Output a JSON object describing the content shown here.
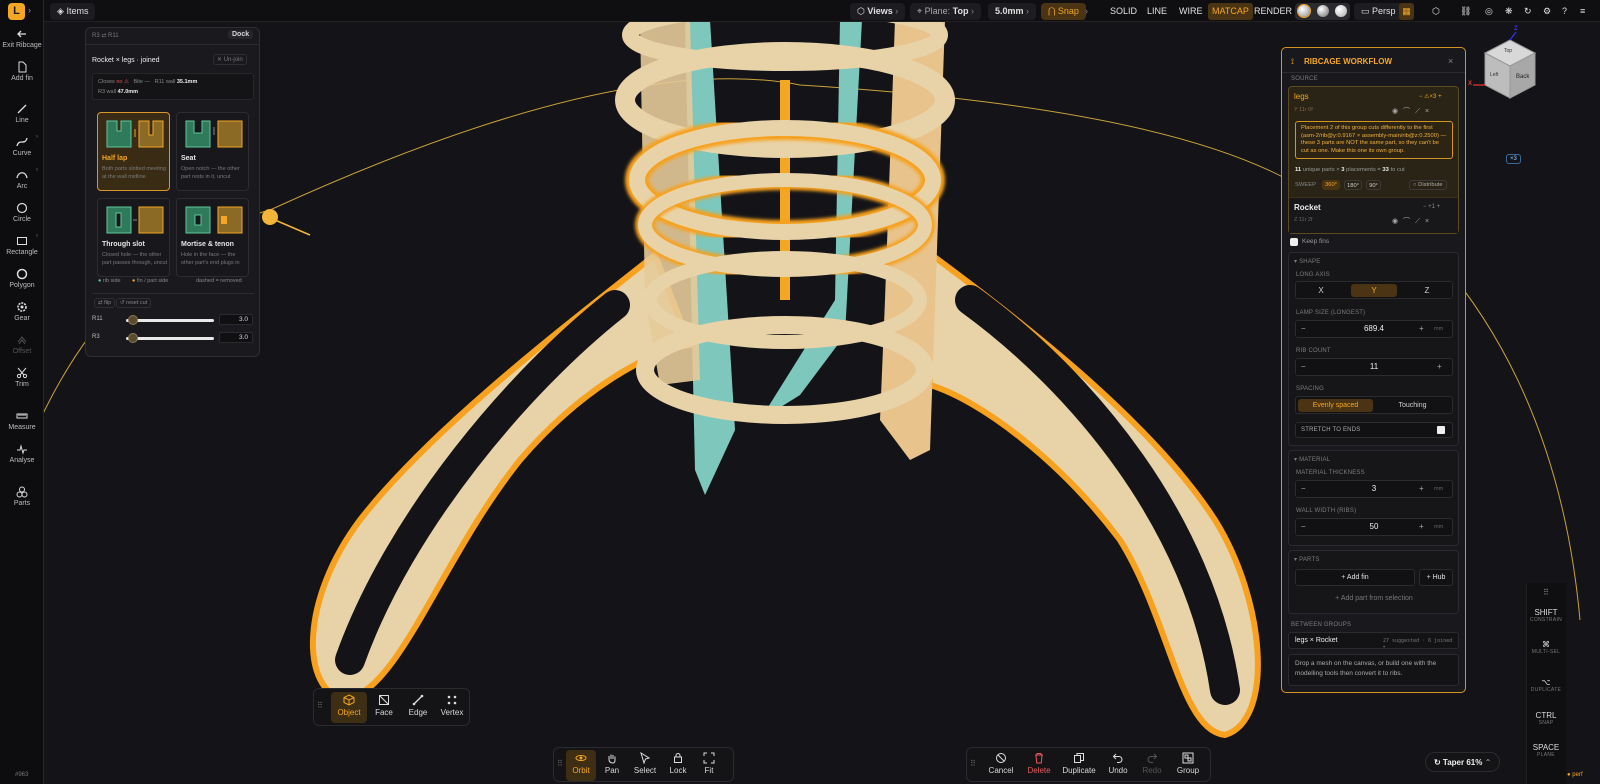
{
  "app": {
    "logo_letter": "L",
    "accent": "#f5a623",
    "build": "#963"
  },
  "left_tools": [
    {
      "label": "Exit Ribcage",
      "icon": "arrow-left-icon"
    },
    {
      "label": "Add fin",
      "icon": "file-icon"
    },
    {
      "label": "Line",
      "icon": "line-icon"
    },
    {
      "label": "Curve",
      "icon": "curve-icon"
    },
    {
      "label": "Arc",
      "icon": "arc-icon"
    },
    {
      "label": "Circle",
      "icon": "circle-icon"
    },
    {
      "label": "Rectangle",
      "icon": "rectangle-icon"
    },
    {
      "label": "Polygon",
      "icon": "polygon-icon"
    },
    {
      "label": "Gear",
      "icon": "gear-icon"
    },
    {
      "label": "Offset",
      "icon": "offset-icon"
    },
    {
      "label": "Trim",
      "icon": "scissors-icon"
    },
    {
      "label": "Measure",
      "icon": "ruler-icon"
    },
    {
      "label": "Analyse",
      "icon": "pulse-icon"
    },
    {
      "label": "Parts",
      "icon": "parts-icon"
    }
  ],
  "topbar": {
    "items_label": "Items",
    "views_label": "Views",
    "plane_label": "Plane:",
    "plane_value": "Top",
    "grid_value": "5.0mm",
    "snap_label": "Snap",
    "modes": [
      "SOLID",
      "LINE",
      "WIRE",
      "MATCAP",
      "RENDER"
    ],
    "active_mode": "MATCAP",
    "projection": "Persp"
  },
  "joint_panel": {
    "header": "R3 ⇄ R11",
    "dock_label": "Dock",
    "title": "Rocket × legs · joined",
    "unjoin_label": "✕ Un-join",
    "closes_label": "Closes",
    "closes_value": "no ⚠",
    "bite_label": "Bite",
    "bite_value": "—",
    "r11_wall_label": "R11 wall",
    "r11_wall_value": "35.1mm",
    "r3_wall_label": "R3 wall",
    "r3_wall_value": "47.0mm",
    "joints": [
      {
        "title": "Half lap",
        "desc": "Both parts slotted meeting at the wall midline",
        "selected": true
      },
      {
        "title": "Seat",
        "desc": "Open notch — the other part rests in it, uncut",
        "selected": false
      },
      {
        "title": "Through slot",
        "desc": "Closed hole — the other part passes through, uncut",
        "selected": false
      },
      {
        "title": "Mortise & tenon",
        "desc": "Hole in the face — the other part's end plugs in",
        "selected": false
      }
    ],
    "legend_rib": "rib side",
    "legend_fin": "fin / part side",
    "legend_dashed": "dashed = removed",
    "flip_label": "⇄ flip",
    "reset_label": "↺ reset cut",
    "sliders": [
      {
        "label": "R11",
        "value": "3.0",
        "fraction": 0.05
      },
      {
        "label": "R3",
        "value": "3.0",
        "fraction": 0.05
      }
    ]
  },
  "workflow": {
    "title": "RIBCAGE WORKFLOW",
    "source_label": "SOURCE",
    "groups": [
      {
        "name": "legs",
        "meta": "Y 11r 0f",
        "badge": "⚠×3"
      },
      {
        "name": "Rocket",
        "meta": "Z 11r 2f",
        "badge": "+1"
      }
    ],
    "warning": "Placement 2 of this group cuts differently to the first (asm-2/rib@y:0.9167 × assembly-main/rib@z:0.2500) — these 3 parts are NOT the same part, so they can't be cut as one. Make this one its own group.",
    "parts_summary_a": "11",
    "parts_summary_b": "unique parts ×",
    "parts_summary_c": "3",
    "parts_summary_d": "placements =",
    "parts_summary_e": "33",
    "parts_summary_f": "to cut",
    "sweep_label": "SWEEP",
    "sweep_options": [
      "360°",
      "180°",
      "90°"
    ],
    "distribute_label": "Distribute",
    "keep_fins_label": "Keep fins",
    "shape_label": "SHAPE",
    "long_axis_label": "LONG AXIS",
    "axes": [
      "X",
      "Y",
      "Z"
    ],
    "active_axis": "Y",
    "lamp_size_label": "LAMP SIZE (LONGEST)",
    "lamp_size": "689.4",
    "rib_count_label": "RIB COUNT",
    "rib_count": "11",
    "spacing_label": "SPACING",
    "spacing_options": [
      "Evenly spaced",
      "Touching"
    ],
    "stretch_label": "STRETCH TO ENDS",
    "material_label": "MATERIAL",
    "thickness_label": "MATERIAL THICKNESS",
    "thickness": "3",
    "wall_label": "WALL WIDTH (RIBS)",
    "wall": "50",
    "unit": "mm",
    "parts_label": "PARTS",
    "add_fin": "+ Add fin",
    "add_hub": "+ Hub",
    "add_part": "+ Add part from selection",
    "between_label": "BETWEEN GROUPS",
    "between_pair": "legs × Rocket",
    "between_meta": "27 suggested · 6 joined ▸",
    "hint": "Drop a mesh on the canvas, or build one with the modelling tools then convert it to ribs."
  },
  "viewcube": {
    "top": "Top",
    "left": "Left",
    "back": "Back",
    "axis_x": "X",
    "axis_z": "Z",
    "badge": "×3"
  },
  "select_modes": {
    "items": [
      "Object",
      "Face",
      "Edge",
      "Vertex"
    ],
    "active": "Object"
  },
  "nav_bar": {
    "items": [
      "Orbit",
      "Pan",
      "Select",
      "Lock",
      "Fit"
    ],
    "active": "Orbit"
  },
  "edit_bar": {
    "items": [
      "Cancel",
      "Delete",
      "Duplicate",
      "Undo",
      "Redo",
      "Group"
    ]
  },
  "shortcuts": [
    {
      "key": "SHIFT",
      "desc": "CONSTRAIN"
    },
    {
      "key": "⌘",
      "desc": "MULTI-SEL"
    },
    {
      "key": "⌥",
      "desc": "DUPLICATE"
    },
    {
      "key": "CTRL",
      "desc": "SNAP"
    },
    {
      "key": "SPACE",
      "desc": "PLANE"
    }
  ],
  "perf_label": "● perf",
  "taper_label": "↻ Taper 61%"
}
